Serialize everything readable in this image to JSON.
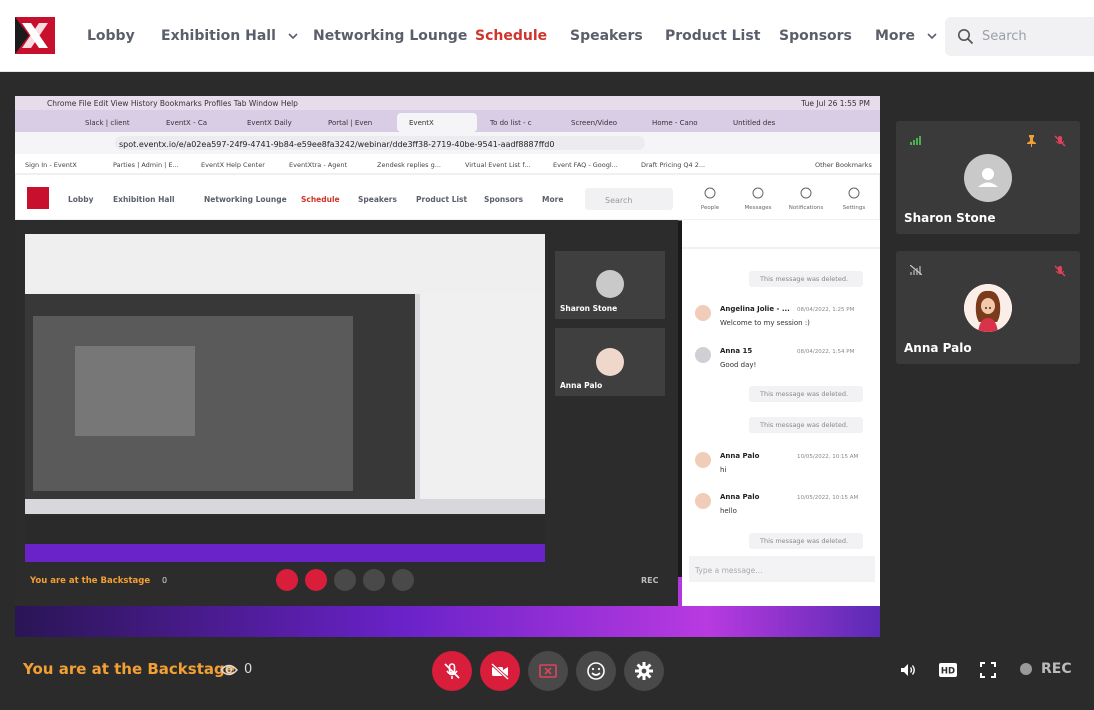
{
  "nav": {
    "items": [
      {
        "label": "Lobby",
        "active": false,
        "dropdown": false
      },
      {
        "label": "Exhibition Hall",
        "active": false,
        "dropdown": true
      },
      {
        "label": "Networking Lounge",
        "active": false,
        "dropdown": false
      },
      {
        "label": "Schedule",
        "active": true,
        "dropdown": false
      },
      {
        "label": "Speakers",
        "active": false,
        "dropdown": false
      },
      {
        "label": "Product List",
        "active": false,
        "dropdown": false
      },
      {
        "label": "Sponsors",
        "active": false,
        "dropdown": false
      },
      {
        "label": "More",
        "active": false,
        "dropdown": true
      }
    ],
    "search_placeholder": "Search"
  },
  "stage": {
    "screen_share": {
      "mac_menubar": [
        "Chrome",
        "File",
        "Edit",
        "View",
        "History",
        "Bookmarks",
        "Profiles",
        "Tab",
        "Window",
        "Help"
      ],
      "clock": "Tue Jul 26  1:55 PM",
      "browser_tabs": [
        "Slack | client",
        "EventX - Ca",
        "EventX Daily",
        "Portal | Even",
        "EventX",
        "To do list - c",
        "Screen/Video",
        "Home - Cano",
        "Untitled des"
      ],
      "url": "spot.eventx.io/e/a02ea597-24f9-4741-9b84-e59ee8fa3242/webinar/dde3ff38-2719-40be-9541-aadf8887ffd0",
      "bookmarks": [
        "Sign In - EventX",
        "Parties | Admin | E...",
        "EventX Help Center",
        "EventXtra - Agent",
        "Zendesk replies g...",
        "Virtual Event List f...",
        "Event FAQ - Googl...",
        "Draft Pricing Q4 2...",
        "Other Bookmarks"
      ],
      "app_nav": [
        "Lobby",
        "Exhibition Hall",
        "Networking Lounge",
        "Schedule",
        "Speakers",
        "Product List",
        "Sponsors",
        "More"
      ],
      "app_search": "Search",
      "app_icons": [
        "People",
        "Messages",
        "Notifications",
        "Settings"
      ],
      "tiles": [
        "Sharon Stone",
        "Anna Palo"
      ],
      "chat": [
        {
          "type": "deleted",
          "text": "This message was deleted."
        },
        {
          "type": "msg",
          "author": "Angelina Jolie - ...",
          "time": "08/04/2022, 1:25 PM",
          "text": "Welcome to my session :)"
        },
        {
          "type": "msg",
          "author": "Anna 15",
          "time": "08/04/2022, 1:54 PM",
          "text": "Good day!"
        },
        {
          "type": "deleted",
          "text": "This message was deleted."
        },
        {
          "type": "deleted",
          "text": "This message was deleted."
        },
        {
          "type": "msg",
          "author": "Anna Palo",
          "time": "10/05/2022, 10:15 AM",
          "text": "hi"
        },
        {
          "type": "msg",
          "author": "Anna Palo",
          "time": "10/05/2022, 10:15 AM",
          "text": "hello"
        },
        {
          "type": "deleted",
          "text": "This message was deleted."
        }
      ],
      "chat_placeholder": "Type a message...",
      "backstage_text": "You are at the Backstage",
      "viewer_count": "0",
      "rec_label": "REC"
    }
  },
  "participants": [
    {
      "name": "Sharon Stone",
      "signal": "good",
      "pinned": true,
      "muted": true,
      "avatar": "default-avatar"
    },
    {
      "name": "Anna Palo",
      "signal": "none",
      "pinned": false,
      "muted": true,
      "avatar": "photo-avatar"
    }
  ],
  "bottom": {
    "backstage_text": "You are at the Backstage",
    "viewer_count": "0",
    "rec_label": "REC"
  },
  "colors": {
    "brand": "#c8102e",
    "active_nav": "#d0342c",
    "backstage": "#f2a033",
    "control_red": "#d81e3b"
  }
}
